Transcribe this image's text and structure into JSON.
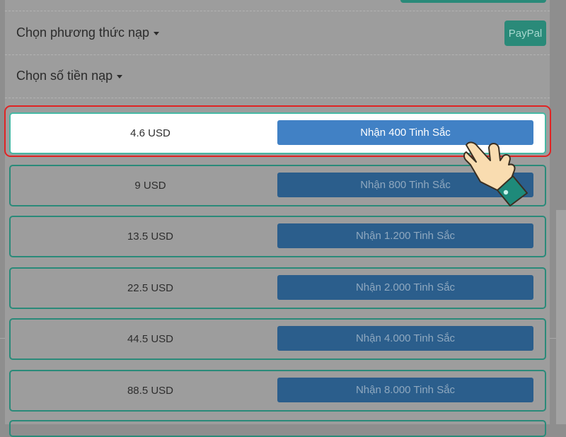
{
  "header": {
    "payment_method_label": "Chọn phương thức nạp",
    "amount_label": "Chọn số tiền nạp",
    "paypal_label": "PayPal"
  },
  "options": [
    {
      "price": "4.6 USD",
      "button": "Nhận 400 Tinh Sắc",
      "selected": true
    },
    {
      "price": "9 USD",
      "button": "Nhận 800 Tinh Sắc"
    },
    {
      "price": "13.5 USD",
      "button": "Nhận 1.200 Tinh Sắc"
    },
    {
      "price": "22.5 USD",
      "button": "Nhận 2.000 Tinh Sắc"
    },
    {
      "price": "44.5 USD",
      "button": "Nhận 4.000 Tinh Sắc"
    },
    {
      "price": "88.5 USD",
      "button": "Nhận 8.000 Tinh Sắc"
    }
  ],
  "annotation": {
    "highlight_color": "#e02424",
    "pointer_icon": "pointing-hand-icon"
  },
  "colors": {
    "accent_teal": "#2a8a79",
    "button_blue": "#2b5e8c",
    "button_blue_active": "#4181c5"
  }
}
